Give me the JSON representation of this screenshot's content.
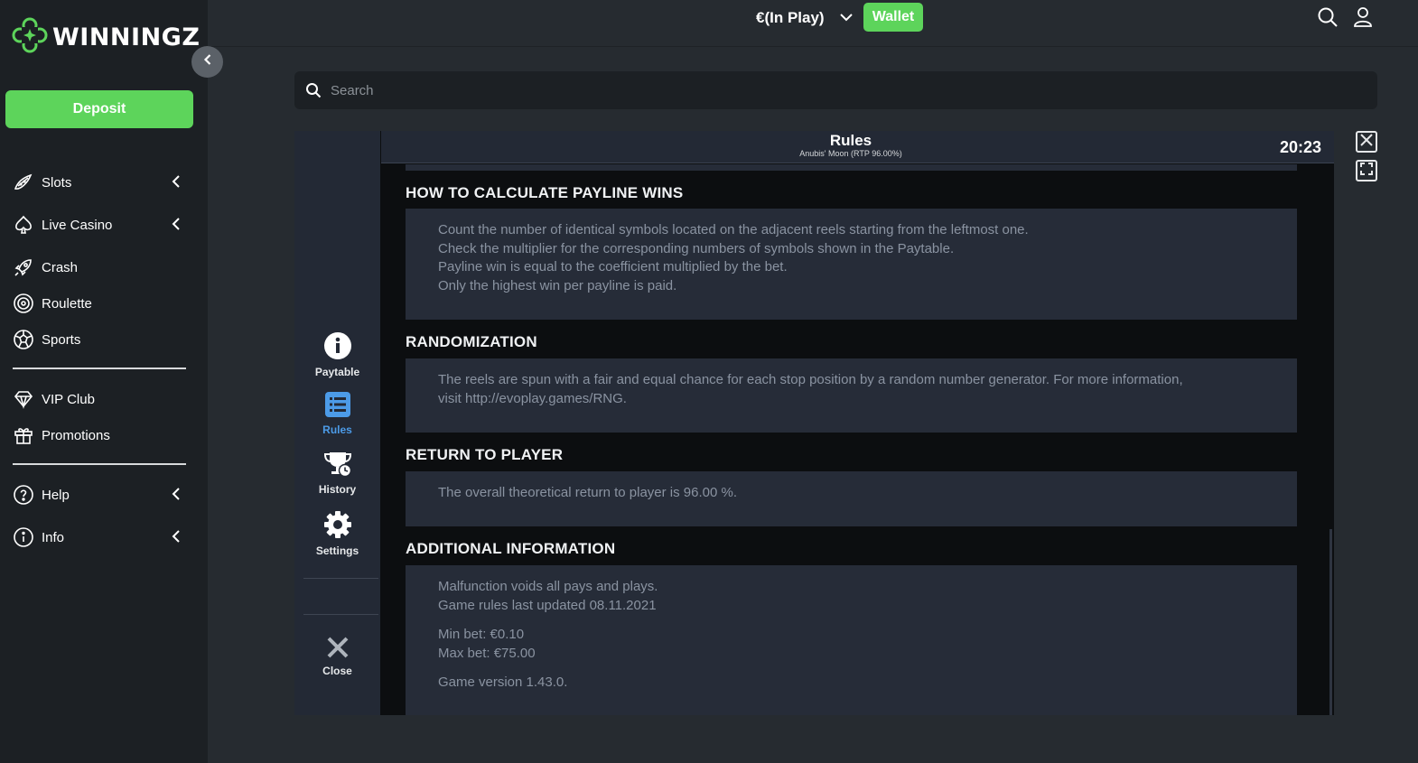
{
  "brand": {
    "name": "WINNINGZ"
  },
  "sidebar": {
    "deposit_label": "Deposit",
    "items": [
      {
        "label": "Slots",
        "icon": "slots-icon"
      },
      {
        "label": "Live Casino",
        "icon": "spade-icon"
      },
      {
        "label": "Crash",
        "icon": "rocket-icon"
      },
      {
        "label": "Roulette",
        "icon": "roulette-icon"
      },
      {
        "label": "Sports",
        "icon": "soccer-ball-icon"
      },
      {
        "label": "VIP Club",
        "icon": "diamond-icon"
      },
      {
        "label": "Promotions",
        "icon": "gift-icon"
      },
      {
        "label": "Help",
        "icon": "question-icon"
      },
      {
        "label": "Info",
        "icon": "info-icon"
      }
    ]
  },
  "topbar": {
    "balance": "€(In Play)",
    "wallet_label": "Wallet"
  },
  "search": {
    "placeholder": "Search"
  },
  "game": {
    "menu": {
      "paytable": "Paytable",
      "rules": "Rules",
      "history": "History",
      "settings": "Settings",
      "close": "Close"
    },
    "header": {
      "title": "Rules",
      "subtitle": "Anubis' Moon (RTP 96.00%)",
      "clock": "20:23"
    },
    "sections": [
      {
        "heading": "HOW TO CALCULATE PAYLINE WINS",
        "lines": [
          "Count the number of identical symbols located on the adjacent reels starting from the leftmost one.",
          "Check the multiplier for the corresponding numbers of symbols shown in the Paytable.",
          "Payline win is equal to the coefficient multiplied by the bet.",
          "Only the highest win per payline is paid."
        ]
      },
      {
        "heading": "RANDOMIZATION",
        "lines": [
          "The reels are spun with a fair and equal chance for each stop position by a random number generator. For more information,",
          "visit http://evoplay.games/RNG."
        ]
      },
      {
        "heading": "RETURN TO PLAYER",
        "lines": [
          "The overall theoretical return to player is 96.00 %."
        ]
      },
      {
        "heading": "ADDITIONAL INFORMATION",
        "lines": [
          "Malfunction voids all pays and plays.",
          "Game rules last updated 08.11.2021",
          "Min bet: €0.10",
          "Max bet: €75.00",
          "Game version 1.43.0."
        ]
      }
    ]
  },
  "colors": {
    "accent_green": "#5dd45b",
    "sidebar_bg": "#1c2024",
    "page_bg": "#262b30",
    "active_blue": "#4c9be8"
  }
}
